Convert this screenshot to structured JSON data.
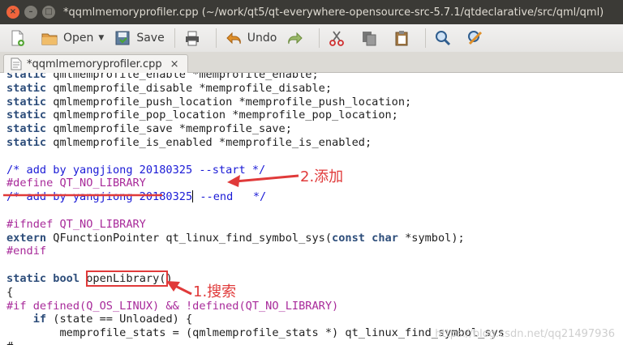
{
  "window": {
    "title": "*qqmlmemoryprofiler.cpp (~/work/qt5/qt-everywhere-opensource-src-5.7.1/qtdeclarative/src/qml/qml)",
    "buttons": {
      "close": "×",
      "minimize": "–",
      "maximize": "□"
    }
  },
  "toolbar": {
    "open_label": "Open",
    "save_label": "Save",
    "undo_label": "Undo"
  },
  "tab": {
    "label": "*qqmlmemoryprofiler.cpp",
    "close": "×"
  },
  "editor_lines": [
    [
      [
        "kw",
        "static"
      ],
      [
        "tx",
        " qmlmemprofile_enable *memprofile_enable;"
      ]
    ],
    [
      [
        "kw",
        "static"
      ],
      [
        "tx",
        " qmlmemprofile_disable *memprofile_disable;"
      ]
    ],
    [
      [
        "kw",
        "static"
      ],
      [
        "tx",
        " qmlmemprofile_push_location *memprofile_push_location;"
      ]
    ],
    [
      [
        "kw",
        "static"
      ],
      [
        "tx",
        " qmlmemprofile_pop_location *memprofile_pop_location;"
      ]
    ],
    [
      [
        "kw",
        "static"
      ],
      [
        "tx",
        " qmlmemprofile_save *memprofile_save;"
      ]
    ],
    [
      [
        "kw",
        "static"
      ],
      [
        "tx",
        " qmlmemprofile_is_enabled *memprofile_is_enabled;"
      ]
    ],
    [],
    [
      [
        "cm",
        "/* add by yangjiong 20180325 --start */"
      ]
    ],
    [
      [
        "pp",
        "#define QT_NO_LIBRARY"
      ]
    ],
    [
      [
        "cm",
        "/* add by yangjiong 20180325"
      ],
      [
        "cursor",
        ""
      ],
      [
        "cm",
        " --end   */"
      ]
    ],
    [],
    [
      [
        "pp",
        "#ifndef QT_NO_LIBRARY"
      ]
    ],
    [
      [
        "kw",
        "extern"
      ],
      [
        "tx",
        " QFunctionPointer qt_linux_find_symbol_sys("
      ],
      [
        "kw",
        "const"
      ],
      [
        "tx",
        " "
      ],
      [
        "kw",
        "char"
      ],
      [
        "tx",
        " *symbol);"
      ]
    ],
    [
      [
        "pp",
        "#endif"
      ]
    ],
    [],
    [
      [
        "kw",
        "static"
      ],
      [
        "tx",
        " "
      ],
      [
        "kw",
        "bool"
      ],
      [
        "tx",
        " openLibrary()"
      ]
    ],
    [
      [
        "tx",
        "{"
      ]
    ],
    [
      [
        "pp",
        "#if defined(Q_OS_LINUX) && !defined(QT_NO_LIBRARY)"
      ]
    ],
    [
      [
        "tx",
        "    "
      ],
      [
        "kw",
        "if"
      ],
      [
        "tx",
        " (state == Unloaded) {"
      ]
    ],
    [
      [
        "tx",
        "        memprofile_stats = (qmlmemprofile_stats *) qt_linux_find_symbol_sys"
      ]
    ],
    [
      [
        "tx",
        "#  . . ."
      ]
    ]
  ],
  "annotations": {
    "add_label": "2.添加",
    "search_label": "1.搜索"
  },
  "watermark": "https://blog.csdn.net/qq21497936",
  "colors": {
    "annotation_red": "#e03a3a",
    "keyword": "#2d4d7a",
    "comment": "#1a1ad6",
    "preprocessor": "#a82a9a"
  }
}
